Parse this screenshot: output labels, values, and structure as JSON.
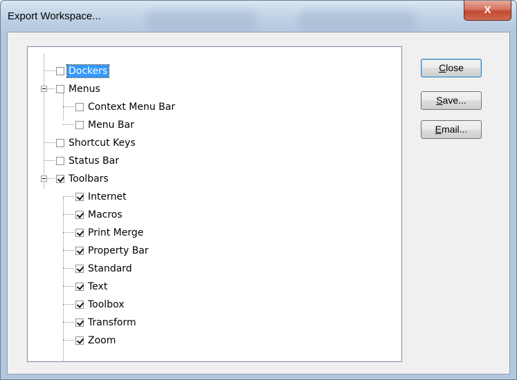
{
  "window": {
    "title": "Export Workspace...",
    "close_glyph": "X",
    "close_icon": "close-x-icon"
  },
  "tree": {
    "items": [
      {
        "label": "Dockers",
        "checked": false,
        "selected": true
      },
      {
        "label": "Menus",
        "checked": false,
        "expanded": true
      },
      {
        "label": "Context Menu Bar",
        "checked": false
      },
      {
        "label": "Menu Bar",
        "checked": false
      },
      {
        "label": "Shortcut Keys",
        "checked": false
      },
      {
        "label": "Status Bar",
        "checked": false
      },
      {
        "label": "Toolbars",
        "checked": true,
        "expanded": true
      },
      {
        "label": "Internet",
        "checked": true
      },
      {
        "label": "Macros",
        "checked": true
      },
      {
        "label": "Print Merge",
        "checked": true
      },
      {
        "label": "Property Bar",
        "checked": true
      },
      {
        "label": "Standard",
        "checked": true
      },
      {
        "label": "Text",
        "checked": true
      },
      {
        "label": "Toolbox",
        "checked": true
      },
      {
        "label": "Transform",
        "checked": true
      },
      {
        "label": "Zoom",
        "checked": true
      }
    ]
  },
  "buttons": {
    "close": {
      "mnemonic": "C",
      "rest": "lose"
    },
    "save": {
      "mnemonic": "S",
      "rest": "ave..."
    },
    "email": {
      "mnemonic": "E",
      "rest": "mail..."
    }
  }
}
